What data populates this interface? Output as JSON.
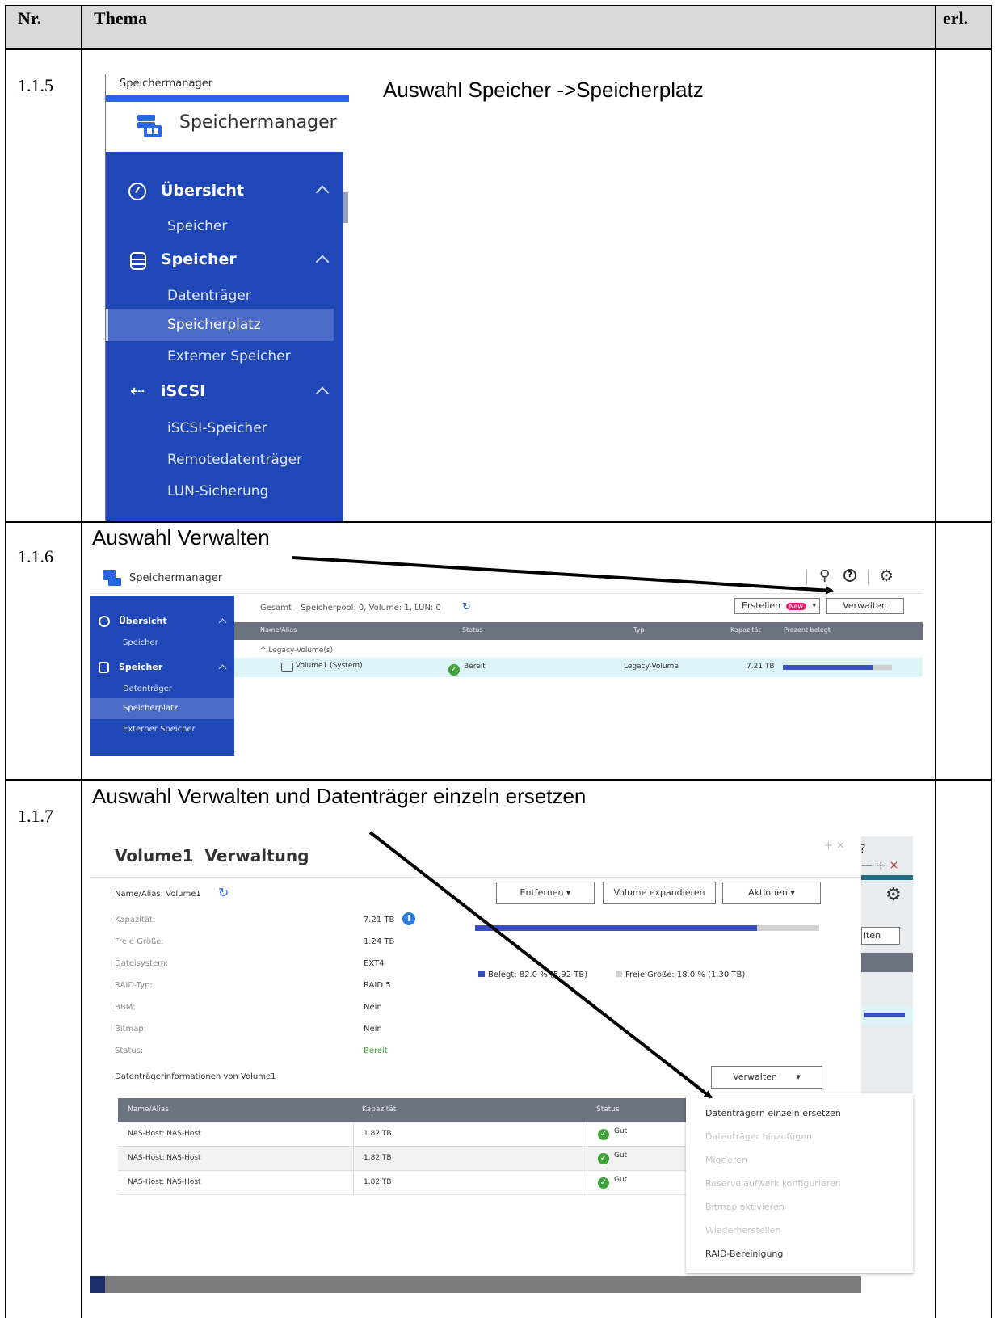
{
  "table": {
    "headers": {
      "nr": "Nr.",
      "thema": "Thema",
      "erl": "erl."
    },
    "rows": [
      {
        "nr": "1.1.5",
        "caption": "Auswahl Speicher ->Speicherplatz"
      },
      {
        "nr": "1.1.6",
        "caption": "Auswahl Verwalten"
      },
      {
        "nr": "1.1.7",
        "caption": "Auswahl Verwalten und Datenträger einzeln ersetzen"
      }
    ]
  },
  "shot1": {
    "breadcrumb": "Speichermanager",
    "app_title": "Speichermanager",
    "menu": {
      "overview": "Übersicht",
      "overview_sub": "Speicher",
      "storage": "Speicher",
      "storage_subs": [
        "Datenträger",
        "Speicherplatz",
        "Externer Speicher"
      ],
      "iscsi": "iSCSI",
      "iscsi_subs": [
        "iSCSI-Speicher",
        "Remotedatenträger",
        "LUN-Sicherung"
      ]
    }
  },
  "shot2": {
    "app_title": "Speichermanager",
    "menu": {
      "overview": "Übersicht",
      "overview_sub": "Speicher",
      "storage": "Speicher",
      "subs": [
        "Datenträger",
        "Speicherplatz",
        "Externer Speicher"
      ]
    },
    "summary": "Gesamt – Speicherpool: 0, Volume: 1, LUN: 0",
    "create_button": "Erstellen",
    "new_badge": "New",
    "manage_button": "Verwalten",
    "columns": [
      "Name/Alias",
      "Status",
      "Typ",
      "Kapazität",
      "Prozent belegt"
    ],
    "group_label": "Legacy-Volume(s)",
    "volume": {
      "name": "Volume1 (System)",
      "status": "Bereit",
      "type": "Legacy-Volume",
      "capacity": "7.21 TB",
      "used_fraction": 0.82
    }
  },
  "shot3": {
    "title": "Volume1  Verwaltung",
    "name_alias": "Name/Alias: Volume1",
    "buttons": {
      "remove": "Entfernen",
      "expand": "Volume expandieren",
      "actions": "Aktionen"
    },
    "props": [
      {
        "label": "Kapazität:",
        "value": "7.21 TB"
      },
      {
        "label": "Freie Größe:",
        "value": "1.24 TB"
      },
      {
        "label": "Dateisystem:",
        "value": "EXT4"
      },
      {
        "label": "RAID-Typ:",
        "value": "RAID 5"
      },
      {
        "label": "BBM:",
        "value": "Nein"
      },
      {
        "label": "Bitmap:",
        "value": "Nein"
      },
      {
        "label": "Status:",
        "value": "Bereit"
      }
    ],
    "used_fraction": 0.82,
    "legend_used": "Belegt: 82.0 % (5.92 TB)",
    "legend_free": "Freie Größe: 18.0 % (1.30 TB)",
    "disk_info_label": "Datenträgerinformationen von Volume1",
    "manage_button": "Verwalten",
    "disk_columns": [
      "Name/Alias",
      "Kapazität",
      "Status"
    ],
    "disks": [
      {
        "name": "NAS-Host: NAS-Host",
        "capacity": "1.82 TB",
        "status": "Gut"
      },
      {
        "name": "NAS-Host: NAS-Host",
        "capacity": "1.82 TB",
        "status": "Gut"
      },
      {
        "name": "NAS-Host: NAS-Host",
        "capacity": "1.82 TB",
        "status": "Gut"
      }
    ],
    "dropdown": [
      "Datenträgern einzeln ersetzen",
      "Datenträger hinzufügen",
      "Migrieren",
      "Reservelaufwerk konfigurieren",
      "Bitmap aktivieren",
      "Wiederherstellen",
      "RAID-Bereinigung"
    ],
    "bg_button_text": "lten",
    "colors": {
      "accent": "#1f47b8",
      "ok": "#3fa33a",
      "used_bar": "#3a4fc4"
    }
  }
}
